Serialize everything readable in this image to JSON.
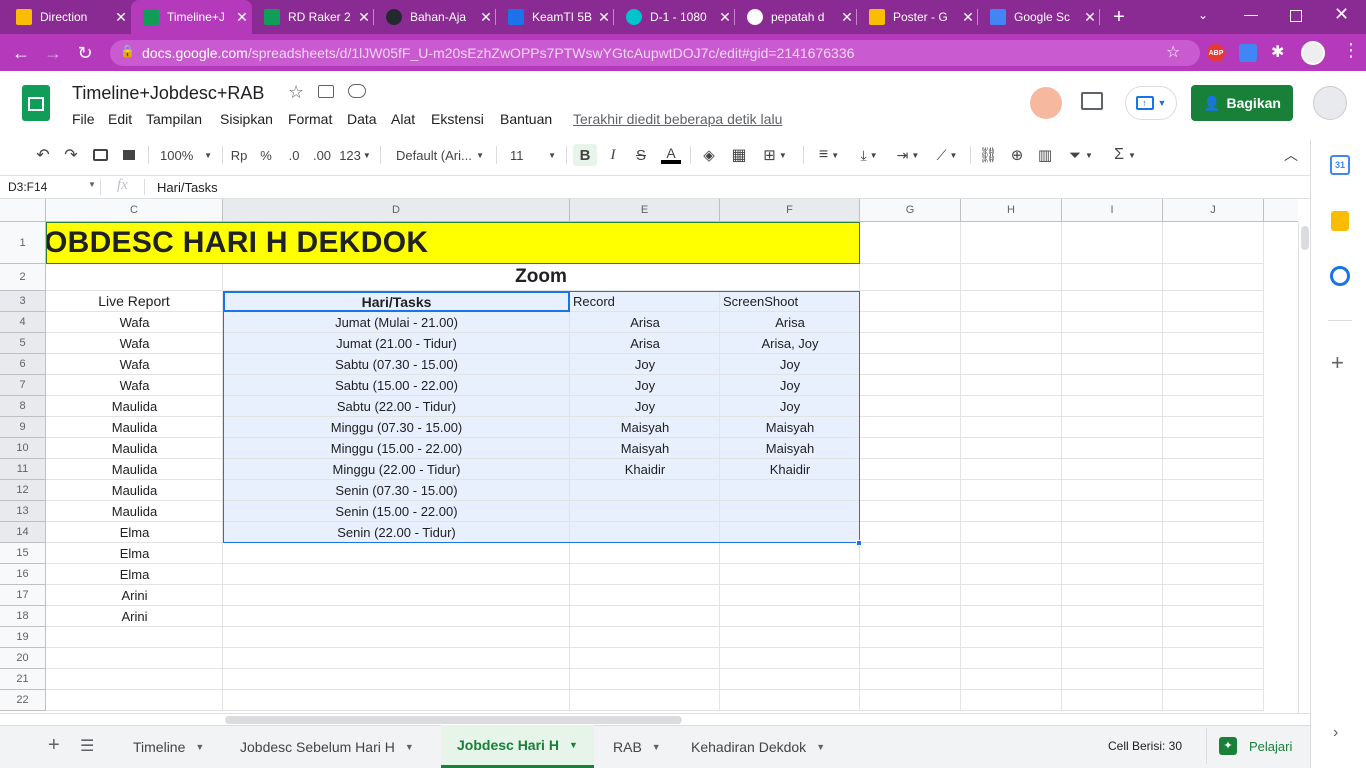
{
  "browser": {
    "tabs": [
      {
        "title": "Direction",
        "icon": "drive-icon",
        "active": false
      },
      {
        "title": "Timeline+J",
        "icon": "sheets-icon",
        "active": true
      },
      {
        "title": "RD Raker 2",
        "icon": "sheets-icon",
        "active": false
      },
      {
        "title": "Bahan-Aja",
        "icon": "github-icon",
        "active": false
      },
      {
        "title": "KeamTI 5B",
        "icon": "classroom-icon",
        "active": false
      },
      {
        "title": "D-1 - 1080",
        "icon": "canva-icon",
        "active": false
      },
      {
        "title": "pepatah d",
        "icon": "google-icon",
        "active": false
      },
      {
        "title": "Poster - G",
        "icon": "drive-icon",
        "active": false
      },
      {
        "title": "Google Sc",
        "icon": "scholar-icon",
        "active": false
      }
    ],
    "url_domain": "docs.google.com",
    "url_path": "/spreadsheets/d/1lJW05fF_U-m20sEzhZwOPPs7PTWswYGtcAupwtDOJ7c/edit#gid=2141676336",
    "abp_label": "ABP"
  },
  "doc": {
    "title": "Timeline+Jobdesc+RAB",
    "menus": [
      "File",
      "Edit",
      "Tampilan",
      "Sisipkan",
      "Format",
      "Data",
      "Alat",
      "Ekstensi",
      "Bantuan"
    ],
    "last_edit": "Terakhir diedit beberapa detik lalu",
    "share_label": "Bagikan"
  },
  "toolbar": {
    "zoom": "100%",
    "currency": "Rp",
    "percent": "%",
    "dec_less": ".0",
    "dec_more": ".00",
    "number_format": "123",
    "font": "Default (Ari...",
    "font_size": "11",
    "bold": "B",
    "italic": "I",
    "strike": "S",
    "text_color": "A"
  },
  "formula_bar": {
    "name_box": "D3:F14",
    "fx": "fx",
    "content": "Hari/Tasks"
  },
  "grid": {
    "columns": [
      "C",
      "D",
      "E",
      "F",
      "G",
      "H",
      "I",
      "J"
    ],
    "row_numbers": [
      "1",
      "2",
      "3",
      "4",
      "5",
      "6",
      "7",
      "8",
      "9",
      "10",
      "11",
      "12",
      "13",
      "14",
      "15",
      "16",
      "17",
      "18",
      "19",
      "20",
      "21",
      "22"
    ],
    "title": "JOBDESC HARI H DEKDOK",
    "subtitle": "Zoom",
    "headers": {
      "c": "Live Report",
      "d": "Hari/Tasks",
      "e": "Record",
      "f": "ScreenShoot"
    },
    "rows": [
      {
        "c": "Wafa",
        "d": "Jumat (Mulai - 21.00)",
        "e": "Arisa",
        "f": "Arisa"
      },
      {
        "c": "Wafa",
        "d": "Jumat (21.00 - Tidur)",
        "e": "Arisa",
        "f": "Arisa, Joy"
      },
      {
        "c": "Wafa",
        "d": "Sabtu (07.30 - 15.00)",
        "e": "Joy",
        "f": "Joy"
      },
      {
        "c": "Wafa",
        "d": "Sabtu (15.00 - 22.00)",
        "e": "Joy",
        "f": "Joy"
      },
      {
        "c": "Maulida",
        "d": "Sabtu (22.00 - Tidur)",
        "e": "Joy",
        "f": "Joy"
      },
      {
        "c": "Maulida",
        "d": "Minggu (07.30 - 15.00)",
        "e": "Maisyah",
        "f": "Maisyah"
      },
      {
        "c": "Maulida",
        "d": "Minggu (15.00 - 22.00)",
        "e": "Maisyah",
        "f": "Maisyah"
      },
      {
        "c": "Maulida",
        "d": "Minggu (22.00 - Tidur)",
        "e": "Khaidir",
        "f": "Khaidir"
      },
      {
        "c": "Maulida",
        "d": "Senin (07.30 - 15.00)",
        "e": "",
        "f": ""
      },
      {
        "c": "Maulida",
        "d": "Senin (15.00 - 22.00)",
        "e": "",
        "f": ""
      },
      {
        "c": "Elma",
        "d": "Senin (22.00 - Tidur)",
        "e": "",
        "f": ""
      },
      {
        "c": "Elma",
        "d": "",
        "e": "",
        "f": ""
      },
      {
        "c": "Elma",
        "d": "",
        "e": "",
        "f": ""
      },
      {
        "c": "Arini",
        "d": "",
        "e": "",
        "f": ""
      },
      {
        "c": "Arini",
        "d": "",
        "e": "",
        "f": ""
      }
    ]
  },
  "sheets": {
    "tabs": [
      {
        "label": "Timeline",
        "active": false
      },
      {
        "label": "Jobdesc Sebelum Hari H",
        "active": false
      },
      {
        "label": "Jobdesc Hari H",
        "active": true
      },
      {
        "label": "RAB",
        "active": false
      },
      {
        "label": "Kehadiran Dekdok",
        "active": false
      }
    ],
    "cell_count": "Cell Berisi: 30",
    "explore_label": "Pelajari"
  },
  "colors": {
    "title_fill": "#ffff00",
    "selection_fill": "#e8f0fe",
    "accent": "#188038",
    "tab_bar": "#8a2a93"
  }
}
